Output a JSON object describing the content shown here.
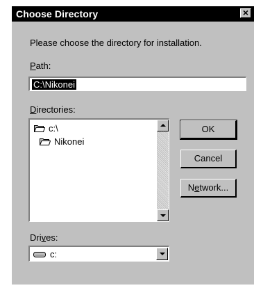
{
  "window": {
    "title": "Choose Directory",
    "close_glyph": "×"
  },
  "prompt": "Please choose the directory for installation.",
  "path": {
    "label_access": "P",
    "label_rest": "ath:",
    "value": "C:\\Nikonei"
  },
  "directories": {
    "label_access": "D",
    "label_rest": "irectories:",
    "items": [
      {
        "label": "c:\\",
        "icon": "folder-open-icon"
      },
      {
        "label": "Nikonei",
        "icon": "folder-open-icon"
      }
    ]
  },
  "buttons": {
    "ok": "OK",
    "cancel": "Cancel",
    "network_pre": "N",
    "network_access": "e",
    "network_post": "twork..."
  },
  "drives": {
    "label_pre": "Dri",
    "label_access": "v",
    "label_post": "es:",
    "selected": "c:",
    "icon": "drive-icon"
  },
  "colors": {
    "face": "#c0c0c0",
    "titlebar": "#000000",
    "selection": "#000000"
  }
}
